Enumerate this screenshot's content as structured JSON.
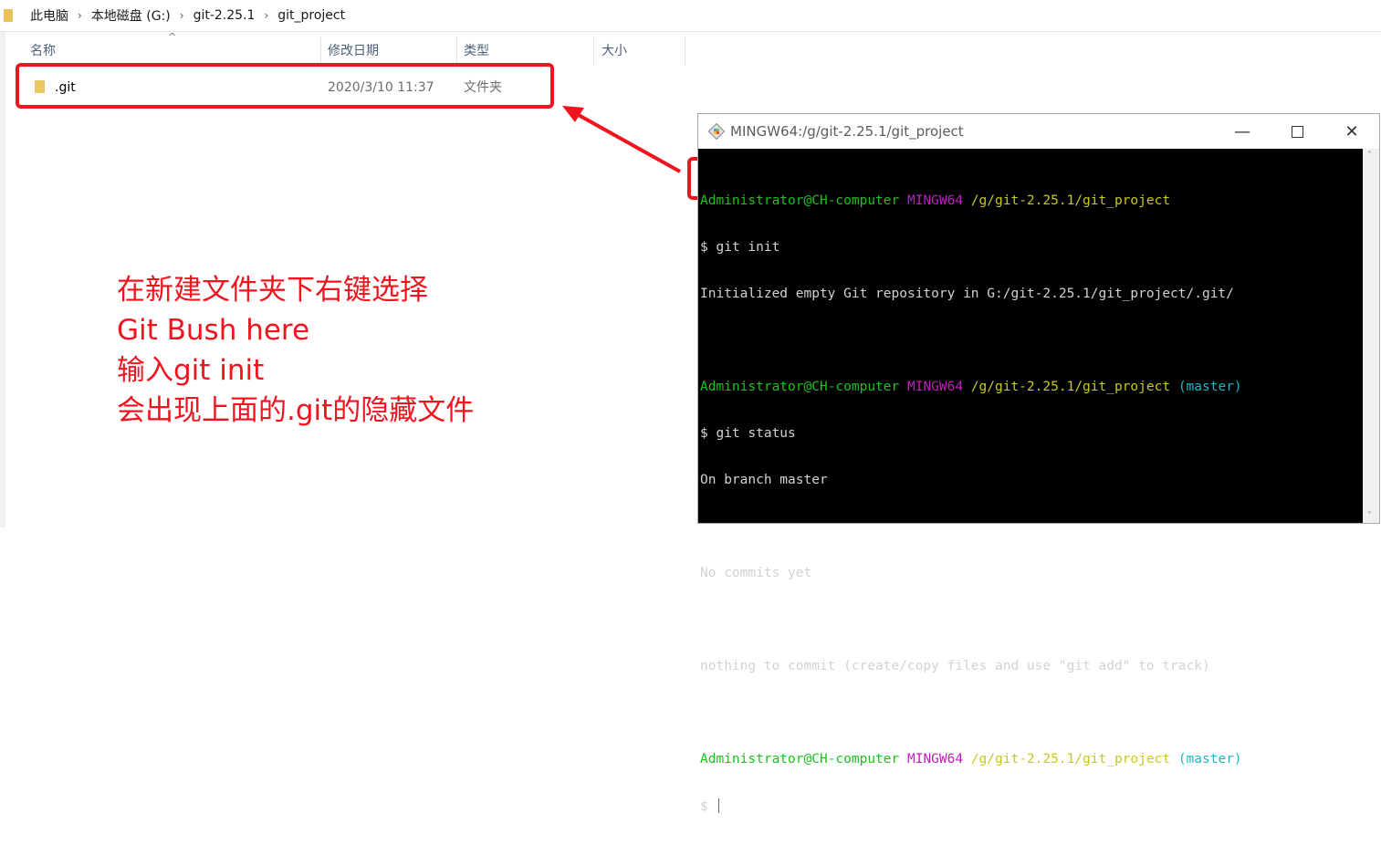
{
  "breadcrumb": [
    "此电脑",
    "本地磁盘 (G:)",
    "git-2.25.1",
    "git_project"
  ],
  "columns": {
    "name": "名称",
    "modified": "修改日期",
    "type": "类型",
    "size": "大小"
  },
  "files": [
    {
      "name": ".git",
      "modified": "2020/3/10 11:37",
      "type": "文件夹"
    }
  ],
  "annotation": {
    "lines": [
      "在新建文件夹下右键选择",
      "Git Bush here",
      "输入git init",
      "会出现上面的.git的隐藏文件"
    ],
    "color": "#f0141e"
  },
  "terminal": {
    "title": "MINGW64:/g/git-2.25.1/git_project",
    "prompt_user": "Administrator@CH-computer",
    "prompt_env": "MINGW64",
    "prompt_path": "/g/git-2.25.1/git_project",
    "prompt_branch": "(master)",
    "cmd1": "$ git init",
    "out1": "Initialized empty Git repository in G:/git-2.25.1/git_project/.git/",
    "cmd2": "$ git status",
    "out2a": "On branch master",
    "out2b": "No commits yet",
    "out2c": "nothing to commit (create/copy files and use \"git add\" to track)",
    "cmd3": "$"
  }
}
